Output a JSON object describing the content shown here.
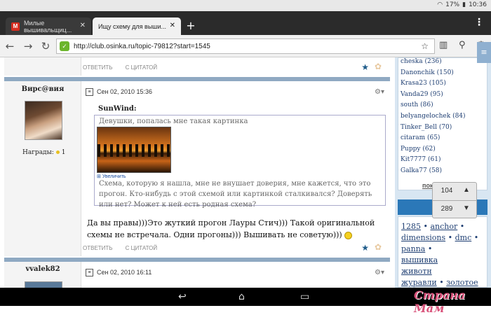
{
  "status": {
    "battery": "17%",
    "time": "10:36"
  },
  "tabs": [
    {
      "favicon": "M",
      "title": "Милые вышивальщиц..."
    },
    {
      "title": "Ищу схему для выши..."
    }
  ],
  "address": {
    "url": "http://club.osinka.ru/topic-79812?start=1545"
  },
  "post_actions": {
    "reply": "ОТВЕТИТЬ",
    "quote": "С ЦИТАТОЙ"
  },
  "post1": {
    "author": "Вирс@вия",
    "awards_label": "Награды:",
    "awards_count": "1",
    "date": "Сен 02, 2010 15:36",
    "quote_author": "SunWind:",
    "quote_line1": "Девушки, попалась мне такая картинка",
    "enlarge": "Увеличить",
    "quote_body": "Схема, которую я нашла, мне не внушает доверия, мне кажется, что это прогон. Кто-нибудь с этой схемой или картинкой сталкивался? Доверять или нет? Может к ней есть родная схема?",
    "reply": "Да вы правы)))Это жуткий прогон Лауры Стич))) Такой оригинальной схемы не встречала. Одни прогоны))) Вышивать не советую)))"
  },
  "post2": {
    "author": "vvalek82",
    "date": "Сен 02, 2010 16:11"
  },
  "sidebar": {
    "users": [
      "cheska (236)",
      "Danonchik (150)",
      "Krasa23 (105)",
      "Vanda29 (95)",
      "south (86)",
      "belyangelochek (84)",
      "Tinker_Bell (70)",
      "citaram (65)",
      "Puppy (62)",
      "Kit7777 (61)",
      "Galka77 (58)"
    ],
    "show_more": "показать еще",
    "tags_title": "Теги",
    "tags": [
      "1285",
      "anchor",
      "dimensions",
      "dmc",
      "panna",
      "вышивка",
      "животн",
      "журавли",
      "золотое"
    ]
  },
  "pager": {
    "current": "104",
    "total": "289"
  },
  "watermark": "Страна Мам"
}
